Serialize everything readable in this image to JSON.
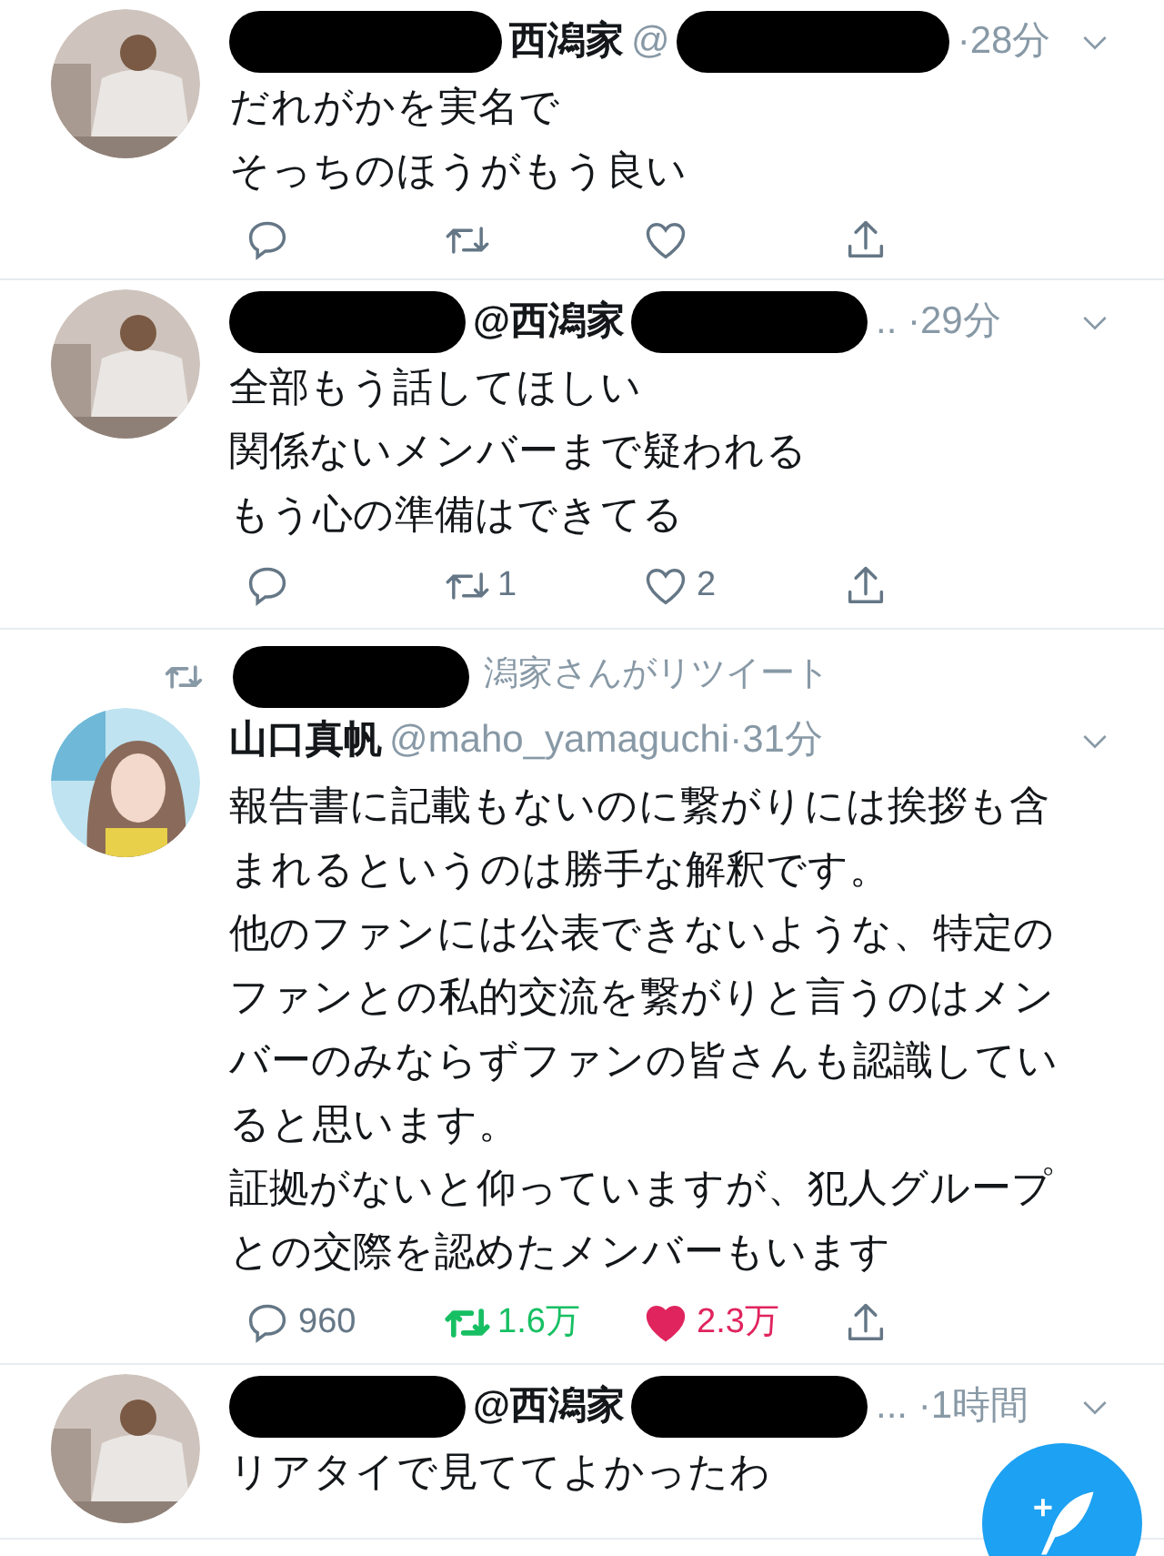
{
  "tweets": [
    {
      "header": [
        {
          "kind": "redacted"
        },
        {
          "kind": "name",
          "text": "西潟家"
        },
        {
          "kind": "handle",
          "text": "@"
        },
        {
          "kind": "redacted"
        },
        {
          "kind": "handle",
          "text": "·28分"
        }
      ],
      "lines": [
        "だれがかを実名で",
        "そっちのほうがもう良い"
      ],
      "actions": {
        "retweeted": false,
        "liked": false
      }
    },
    {
      "header": [
        {
          "kind": "redacted"
        },
        {
          "kind": "name",
          "text": "@西潟家"
        },
        {
          "kind": "redacted"
        },
        {
          "kind": "handle",
          "text": ".. ·29分"
        }
      ],
      "lines": [
        "全部もう話してほしい",
        "関係ないメンバーまで疑われる",
        "もう心の準備はできてる"
      ],
      "actions": {
        "retweet": "1",
        "like": "2",
        "retweeted": false,
        "liked": false
      }
    },
    {
      "retweet_line": [
        {
          "kind": "redacted"
        },
        {
          "kind": "text",
          "text": "潟家さんがリツイート"
        }
      ],
      "header": [
        {
          "kind": "name",
          "text": "山口真帆"
        },
        {
          "kind": "handle",
          "text": "@maho_yamaguchi·31分"
        }
      ],
      "lines": [
        "報告書に記載もないのに繋がりには挨拶も含",
        "まれるというのは勝手な解釈です。",
        "他のファンには公表できないような、特定の",
        "ファンとの私的交流を繋がりと言うのはメン",
        "バーのみならずファンの皆さんも認識してい",
        "ると思います。",
        "証拠がないと仰っていますが、犯人グループ",
        "との交際を認めたメンバーもいます"
      ],
      "actions": {
        "reply": "960",
        "retweet": "1.6万",
        "like": "2.3万",
        "retweeted": true,
        "liked": true
      }
    },
    {
      "header": [
        {
          "kind": "redacted"
        },
        {
          "kind": "name",
          "text": "@西潟家"
        },
        {
          "kind": "redacted"
        },
        {
          "kind": "handle",
          "text": "... ·1時間"
        }
      ],
      "lines": [
        "リアタイで見ててよかったわ"
      ]
    }
  ]
}
